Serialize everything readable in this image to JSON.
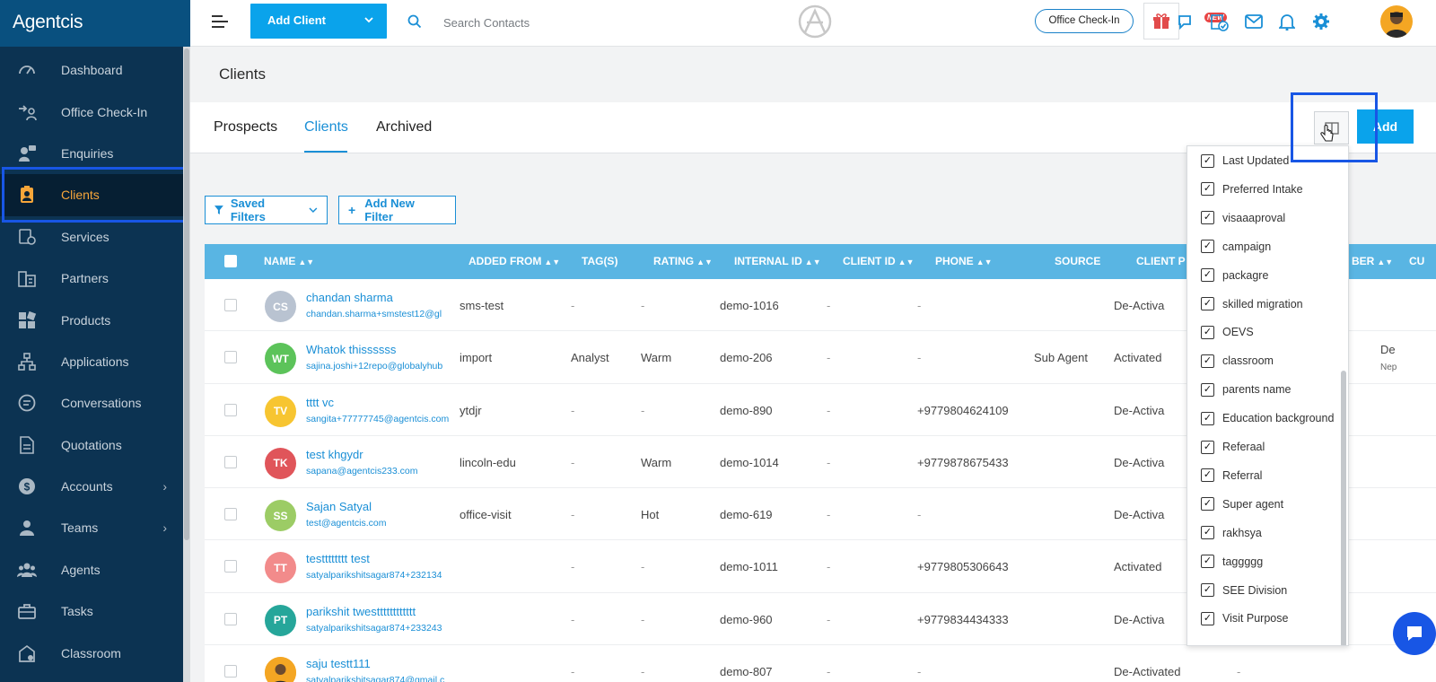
{
  "app": {
    "brand": "Agentcis"
  },
  "sidebar": {
    "items": [
      {
        "label": "Dashboard",
        "icon": "gauge-icon"
      },
      {
        "label": "Office Check-In",
        "icon": "checkin-icon"
      },
      {
        "label": "Enquiries",
        "icon": "enquiries-icon"
      },
      {
        "label": "Clients",
        "icon": "client-badge-icon",
        "active": true
      },
      {
        "label": "Services",
        "icon": "services-icon"
      },
      {
        "label": "Partners",
        "icon": "building-icon"
      },
      {
        "label": "Products",
        "icon": "products-icon"
      },
      {
        "label": "Applications",
        "icon": "flow-icon"
      },
      {
        "label": "Conversations",
        "icon": "chat-icon"
      },
      {
        "label": "Quotations",
        "icon": "document-icon"
      },
      {
        "label": "Accounts",
        "icon": "dollar-icon",
        "has_submenu": true
      },
      {
        "label": "Teams",
        "icon": "team-icon",
        "has_submenu": true
      },
      {
        "label": "Agents",
        "icon": "agents-icon"
      },
      {
        "label": "Tasks",
        "icon": "briefcase-icon"
      },
      {
        "label": "Classroom",
        "icon": "classroom-icon"
      }
    ]
  },
  "topbar": {
    "add_client_label": "Add Client",
    "search_placeholder": "Search Contacts",
    "office_checkin_label": "Office Check-In",
    "new_badge": "NEW"
  },
  "page": {
    "title": "Clients",
    "tabs": [
      "Prospects",
      "Clients",
      "Archived"
    ],
    "active_tab": "Clients",
    "add_button": "Add",
    "saved_filters": "Saved Filters",
    "add_new_filter": "Add New Filter"
  },
  "table": {
    "headers": [
      "NAME",
      "ADDED FROM",
      "TAG(S)",
      "RATING",
      "INTERNAL ID",
      "CLIENT ID",
      "PHONE",
      "SOURCE",
      "CLIENT P",
      "BER",
      "CU"
    ],
    "rows": [
      {
        "initials": "CS",
        "color": "#b9c3d1",
        "name": "chandan sharma",
        "email": "chandan.sharma+smstest12@gl",
        "added_from": "sms-test",
        "tags": "-",
        "rating": "-",
        "internal_id": "demo-1016",
        "client_id": "-",
        "phone": "-",
        "source": "",
        "status": "De-Activa",
        "extra1": "",
        "extra2": ""
      },
      {
        "initials": "WT",
        "color": "#5cc35a",
        "name": "Whatok thissssss",
        "email": "sajina.joshi+12repo@globalyhub",
        "added_from": "import",
        "tags": "Analyst",
        "rating": "Warm",
        "internal_id": "demo-206",
        "client_id": "-",
        "phone": "-",
        "source": "Sub Agent",
        "status": "Activated",
        "extra1": "De",
        "extra2": "Nep"
      },
      {
        "initials": "TV",
        "color": "#f7c531",
        "name": "tttt vc",
        "email": "sangita+77777745@agentcis.com",
        "added_from": "ytdjr",
        "tags": "-",
        "rating": "-",
        "internal_id": "demo-890",
        "client_id": "-",
        "phone": "+9779804624109",
        "source": "",
        "status": "De-Activa",
        "extra1": "",
        "extra2": ""
      },
      {
        "initials": "TK",
        "color": "#e0555a",
        "name": "test khgydr",
        "email": "sapana@agentcis233.com",
        "added_from": "lincoln-edu",
        "tags": "-",
        "rating": "Warm",
        "internal_id": "demo-1014",
        "client_id": "-",
        "phone": "+9779878675433",
        "source": "",
        "status": "De-Activa",
        "extra1": "",
        "extra2": ""
      },
      {
        "initials": "SS",
        "color": "#9ccc65",
        "name": "Sajan Satyal",
        "email": "test@agentcis.com",
        "added_from": "office-visit",
        "tags": "-",
        "rating": "Hot",
        "internal_id": "demo-619",
        "client_id": "-",
        "phone": "-",
        "source": "",
        "status": "De-Activa",
        "extra1": "",
        "extra2": ""
      },
      {
        "initials": "TT",
        "color": "#f28b8b",
        "name": "testttttttt test",
        "email": "satyalparikshitsagar874+232134",
        "added_from": "",
        "tags": "-",
        "rating": "-",
        "internal_id": "demo-1011",
        "client_id": "-",
        "phone": "+9779805306643",
        "source": "",
        "status": "Activated",
        "extra1": "",
        "extra2": ""
      },
      {
        "initials": "PT",
        "color": "#26a69a",
        "name": "parikshit twestttttttttttt",
        "email": "satyalparikshitsagar874+233243",
        "added_from": "",
        "tags": "-",
        "rating": "-",
        "internal_id": "demo-960",
        "client_id": "-",
        "phone": "+9779834434333",
        "source": "",
        "status": "De-Activa",
        "extra1": "",
        "extra2": ""
      },
      {
        "initials": "",
        "color": "#f4a623",
        "name": "saju testt111",
        "email": "satyalparikshitsagar874@gmail.c",
        "added_from": "",
        "tags": "-",
        "rating": "-",
        "internal_id": "demo-807",
        "client_id": "-",
        "phone": "-",
        "source": "",
        "status": "De-Activated",
        "extra1": "-",
        "extra2": ""
      }
    ]
  },
  "column_chooser": {
    "items": [
      "Last Updated",
      "Preferred Intake",
      "visaaaproval",
      "campaign",
      "packagre",
      "skilled migration",
      "OEVS",
      "classroom",
      "parents name",
      "Education background",
      "Referaal",
      "Referral",
      "Super agent",
      "rakhsya",
      "taggggg",
      "SEE Division",
      "Visit Purpose"
    ]
  },
  "colors": {
    "accent": "#0aa3eb",
    "sidebar": "#0c3352",
    "active_nav": "#f7a63a",
    "highlight": "#1856e5"
  }
}
